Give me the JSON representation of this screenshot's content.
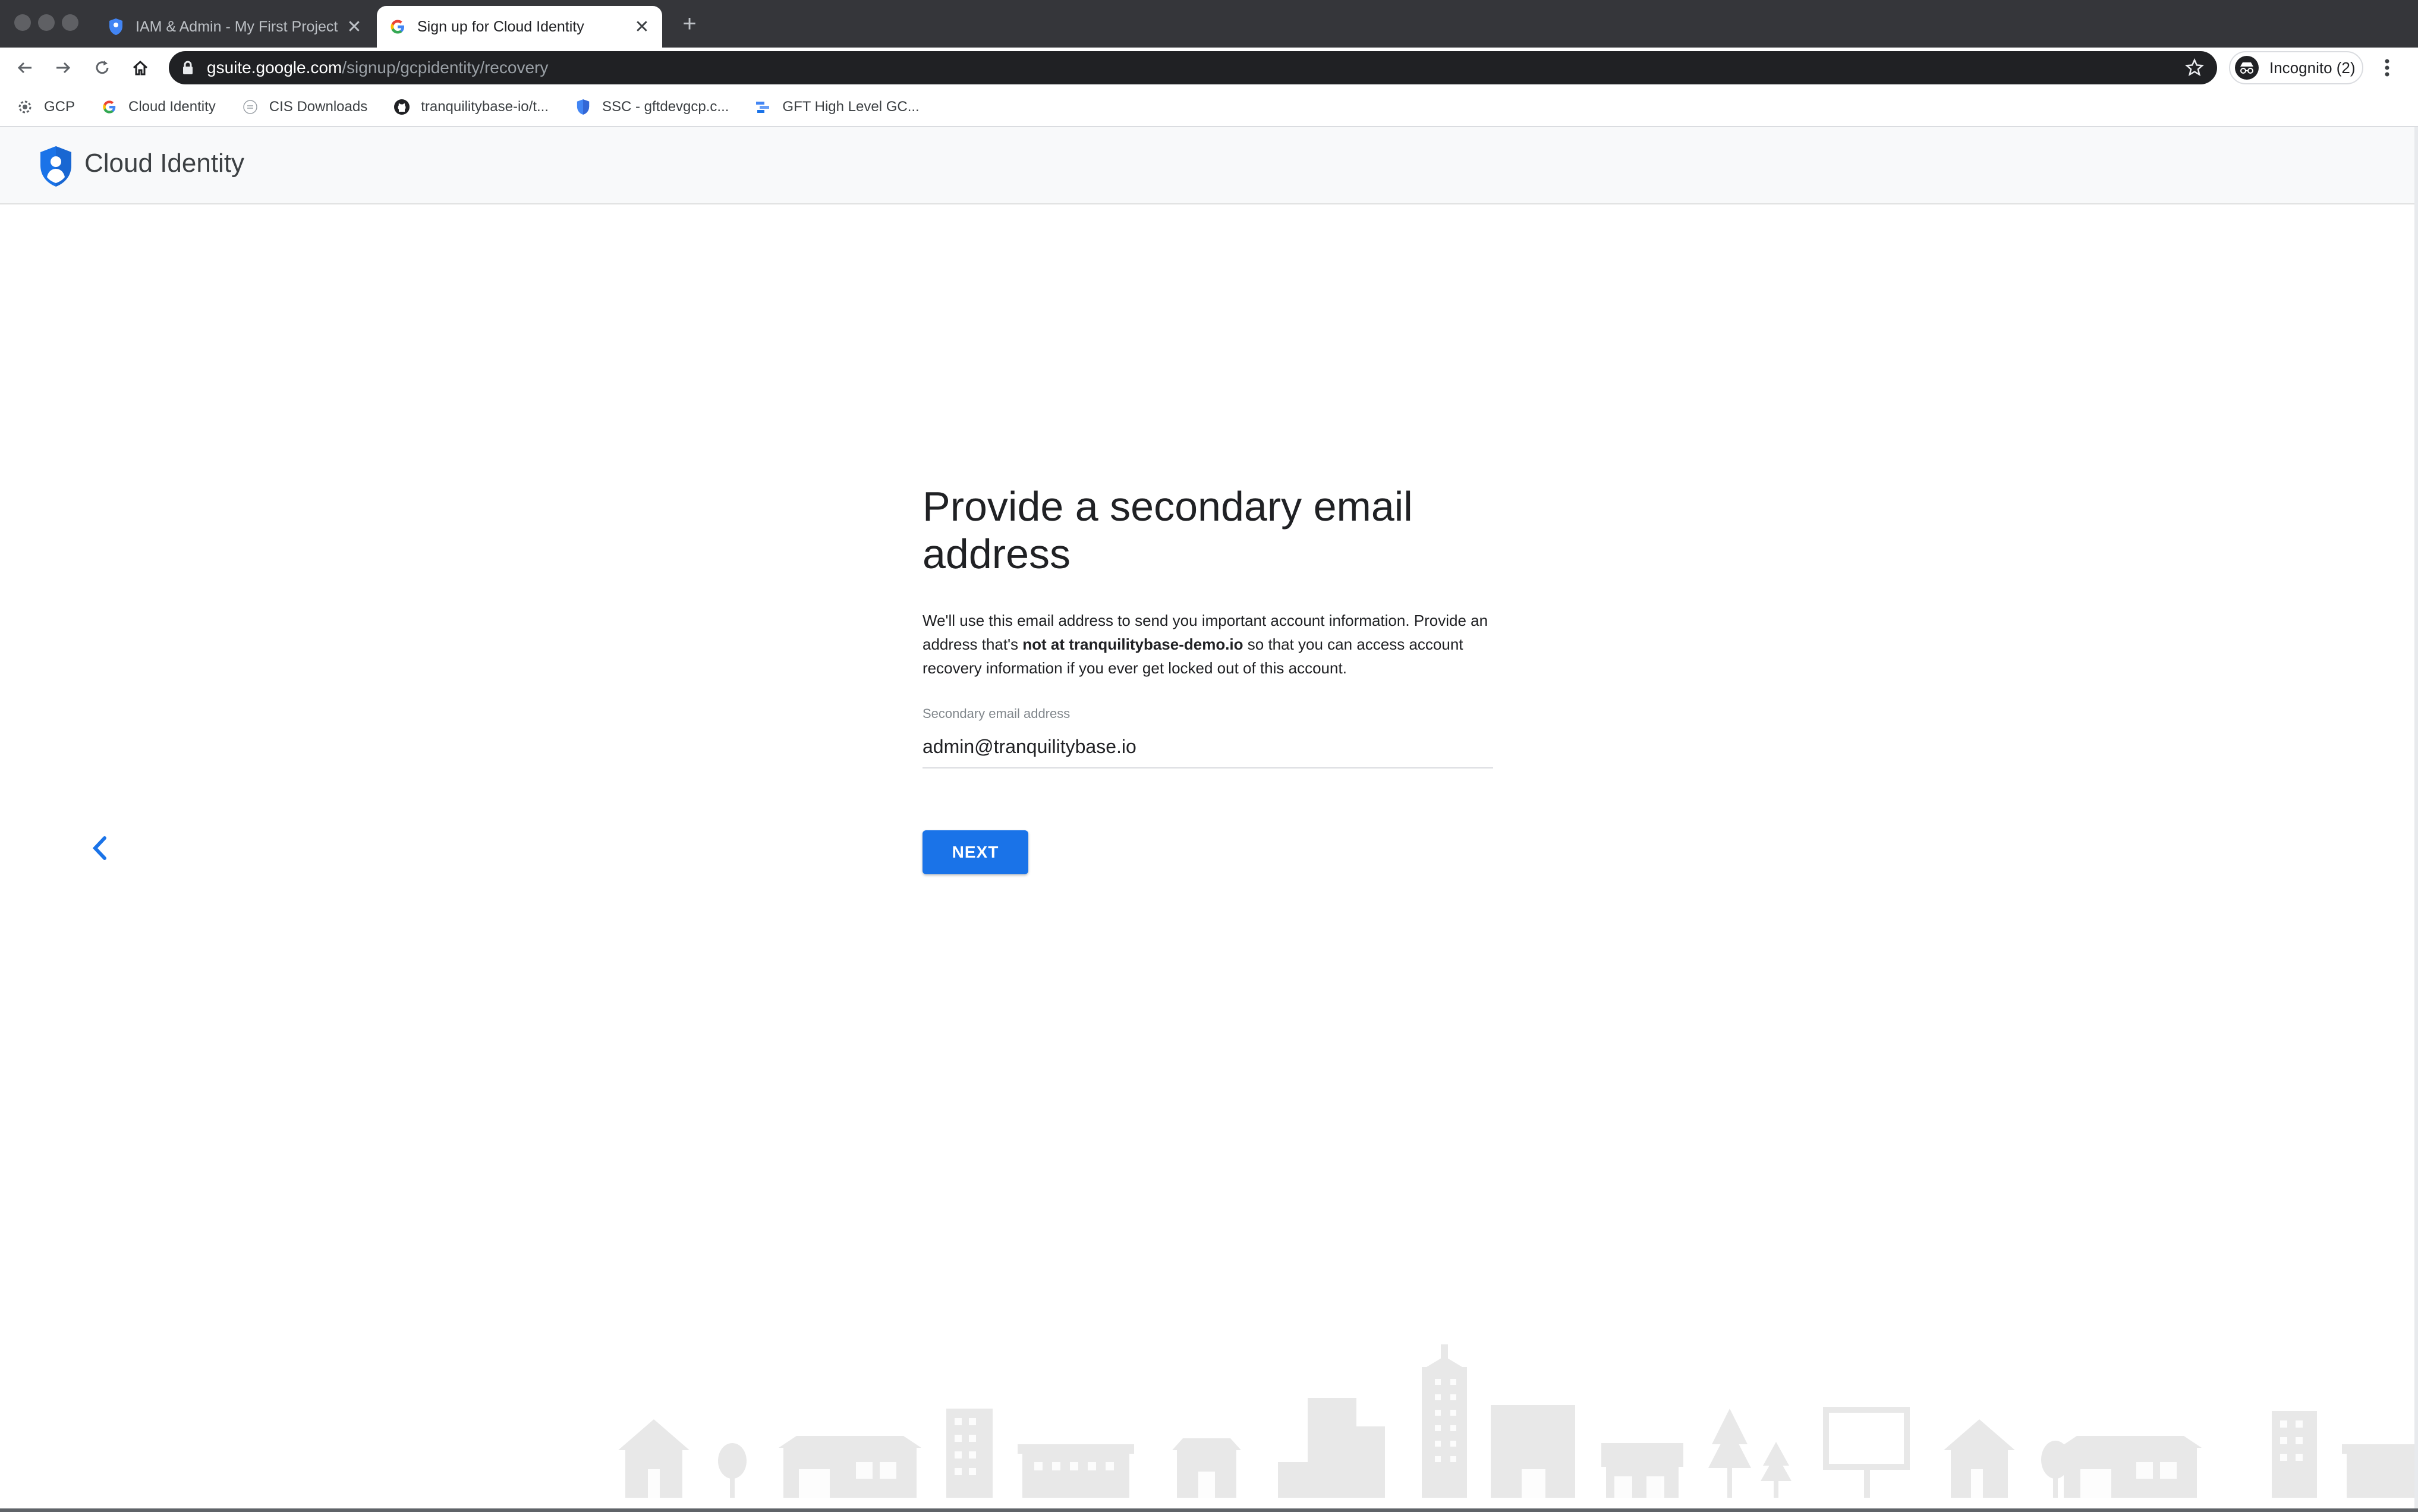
{
  "browser": {
    "tabs": [
      {
        "title": "IAM & Admin - My First Project -",
        "active": false,
        "favicon": "shield-icon"
      },
      {
        "title": "Sign up for Cloud Identity",
        "active": true,
        "favicon": "google-g-icon"
      }
    ],
    "url": {
      "host": "gsuite.google.com",
      "path": "/signup/gcpidentity/recovery"
    },
    "profile_label": "Incognito (2)",
    "bookmarks": [
      {
        "label": "GCP",
        "icon": "gear-icon"
      },
      {
        "label": "Cloud Identity",
        "icon": "google-g-icon"
      },
      {
        "label": "CIS Downloads",
        "icon": "cis-icon"
      },
      {
        "label": "tranquilitybase-io/t...",
        "icon": "github-icon"
      },
      {
        "label": "SSC - gftdevgcp.c...",
        "icon": "shield-icon"
      },
      {
        "label": "GFT High Level GC...",
        "icon": "cloud-icon"
      }
    ]
  },
  "app": {
    "brand": "Cloud Identity"
  },
  "form": {
    "heading": "Provide a secondary email address",
    "description_before": "We'll use this email address to send you important account information. Provide an address that's ",
    "description_bold": "not at tranquilitybase-demo.io",
    "description_after": " so that you can access account recovery information if you ever get locked out of this account.",
    "field_label": "Secondary email address",
    "field_value": "admin@tranquilitybase.io",
    "next_label": "NEXT"
  },
  "colors": {
    "accent": "#1a73e8",
    "tabstrip": "#35363a",
    "omnibox": "#202124"
  }
}
